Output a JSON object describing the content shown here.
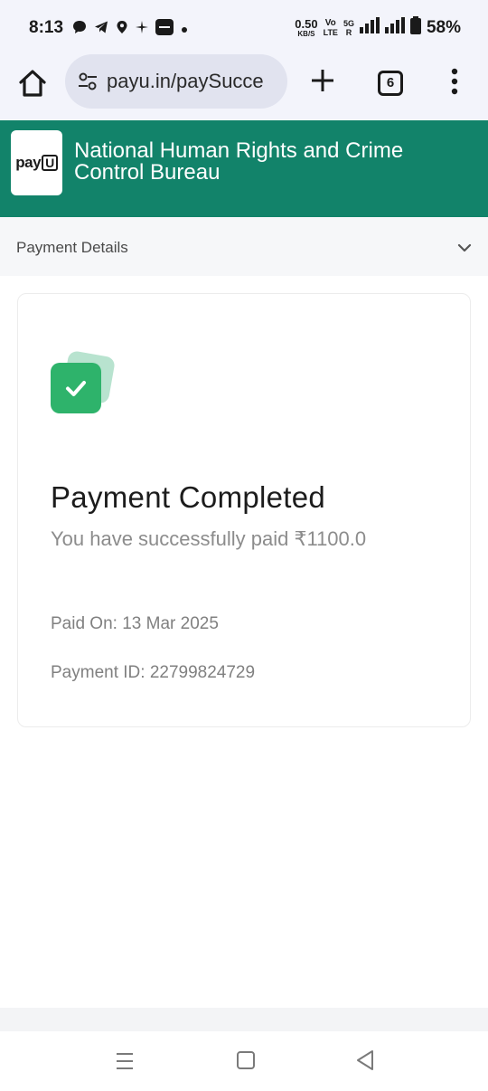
{
  "status_bar": {
    "time": "8:13",
    "speed_value": "0.50",
    "speed_unit": "KB/S",
    "network_top": "Vo",
    "network_bottom": "LTE",
    "network_5g": "5G",
    "network_r": "R",
    "battery": "58%"
  },
  "browser": {
    "url": "payu.in/paySucce",
    "tab_count": "6"
  },
  "merchant": {
    "logo_text": "pay",
    "logo_u": "U",
    "name": "National Human Rights and Crime Control Bureau"
  },
  "details_row": {
    "label": "Payment Details"
  },
  "payment": {
    "title": "Payment Completed",
    "message": "You have successfully paid ₹1100.0",
    "paid_on": "Paid On: 13 Mar 2025",
    "payment_id": "Payment ID: 22799824729"
  },
  "colors": {
    "header_green": "#12836a",
    "success_green": "#2eb36b"
  }
}
